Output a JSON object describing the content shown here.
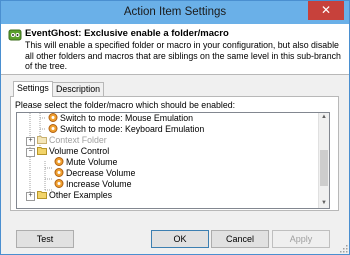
{
  "window": {
    "title": "Action Item Settings",
    "close_glyph": "✕"
  },
  "header": {
    "title": "EventGhost: Exclusive enable a folder/macro",
    "description": "This will enable a specified folder or macro in your configuration, but also disable all other folders and macros that are siblings on the same level in this sub-branch of the tree."
  },
  "tabs": [
    {
      "label": "Settings",
      "active": true
    },
    {
      "label": "Description",
      "active": false
    }
  ],
  "settings": {
    "prompt": "Please select the folder/macro which should be enabled:",
    "tree": [
      {
        "label": "Switch to mode: Mouse Emulation",
        "icon": "macro-icon",
        "greyed": false
      },
      {
        "label": "Switch to mode: Keyboard Emulation",
        "icon": "macro-icon",
        "greyed": false
      },
      {
        "label": "Context Folder",
        "icon": "folder-icon",
        "greyed": true,
        "expander": "+"
      },
      {
        "label": "Volume Control",
        "icon": "folder-open-icon",
        "greyed": false,
        "expander": "−"
      },
      {
        "label": "Mute Volume",
        "icon": "macro-icon",
        "greyed": false
      },
      {
        "label": "Decrease Volume",
        "icon": "macro-icon",
        "greyed": false
      },
      {
        "label": "Increase Volume",
        "icon": "macro-icon",
        "greyed": false
      },
      {
        "label": "Other Examples",
        "icon": "folder-icon",
        "greyed": false,
        "expander": "+"
      }
    ]
  },
  "buttons": {
    "test": "Test",
    "ok": "OK",
    "cancel": "Cancel",
    "apply": "Apply"
  },
  "colors": {
    "accent": "#4a8fd0",
    "titlebar": "#6ab0e8",
    "close": "#c7413b"
  }
}
